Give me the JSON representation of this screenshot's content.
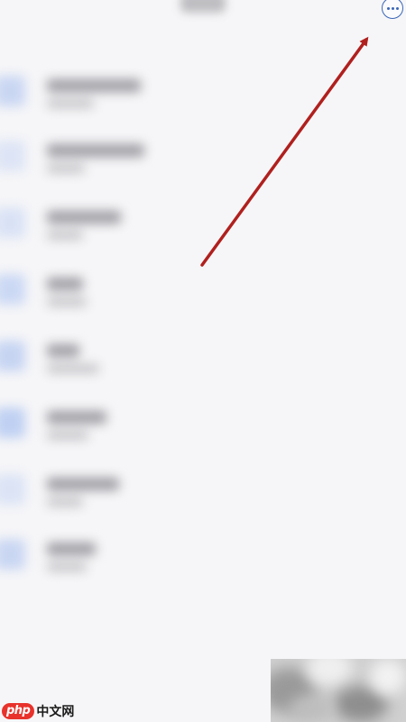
{
  "header": {
    "more_icon": "more-horizontal-icon",
    "accent_color": "#3a66b7"
  },
  "list": {
    "item_count": 8,
    "content_visible": false
  },
  "annotation": {
    "type": "arrow",
    "color": "#b0201e",
    "points_to": "more-button"
  },
  "watermark": {
    "logo_text": "php",
    "site_text": "中文网"
  }
}
